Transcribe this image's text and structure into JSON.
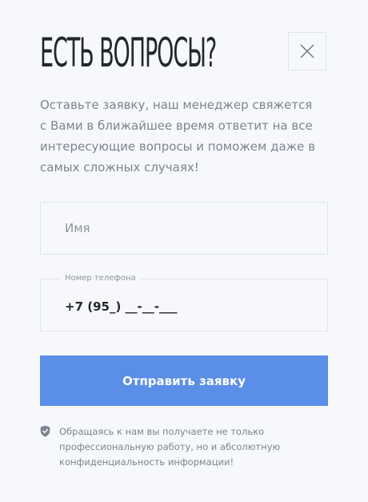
{
  "modal": {
    "title": "ЕСТЬ ВОПРОСЫ?",
    "description": "Оставьте заявку, наш менеджер свяжется с Вами в ближайшее время ответит на все интересующие вопросы и поможем даже в самых сложных случаях!",
    "close_icon": "close-icon"
  },
  "form": {
    "name_field": {
      "placeholder": "Имя",
      "value": ""
    },
    "phone_field": {
      "label": "Номер телефона",
      "value": "+7 (95_) __-__-___"
    },
    "submit_label": "Отправить заявку"
  },
  "notice": {
    "icon": "shield-check-icon",
    "text": "Обращаясь к нам вы получаете не только профессиональную работу, но и абсолютную конфиденциальность информации!"
  },
  "colors": {
    "background": "#f7f8fb",
    "accent": "#5b8ee6",
    "border": "#dfe3ea",
    "muted_text": "#7c8490",
    "heading_text": "#23262b"
  }
}
